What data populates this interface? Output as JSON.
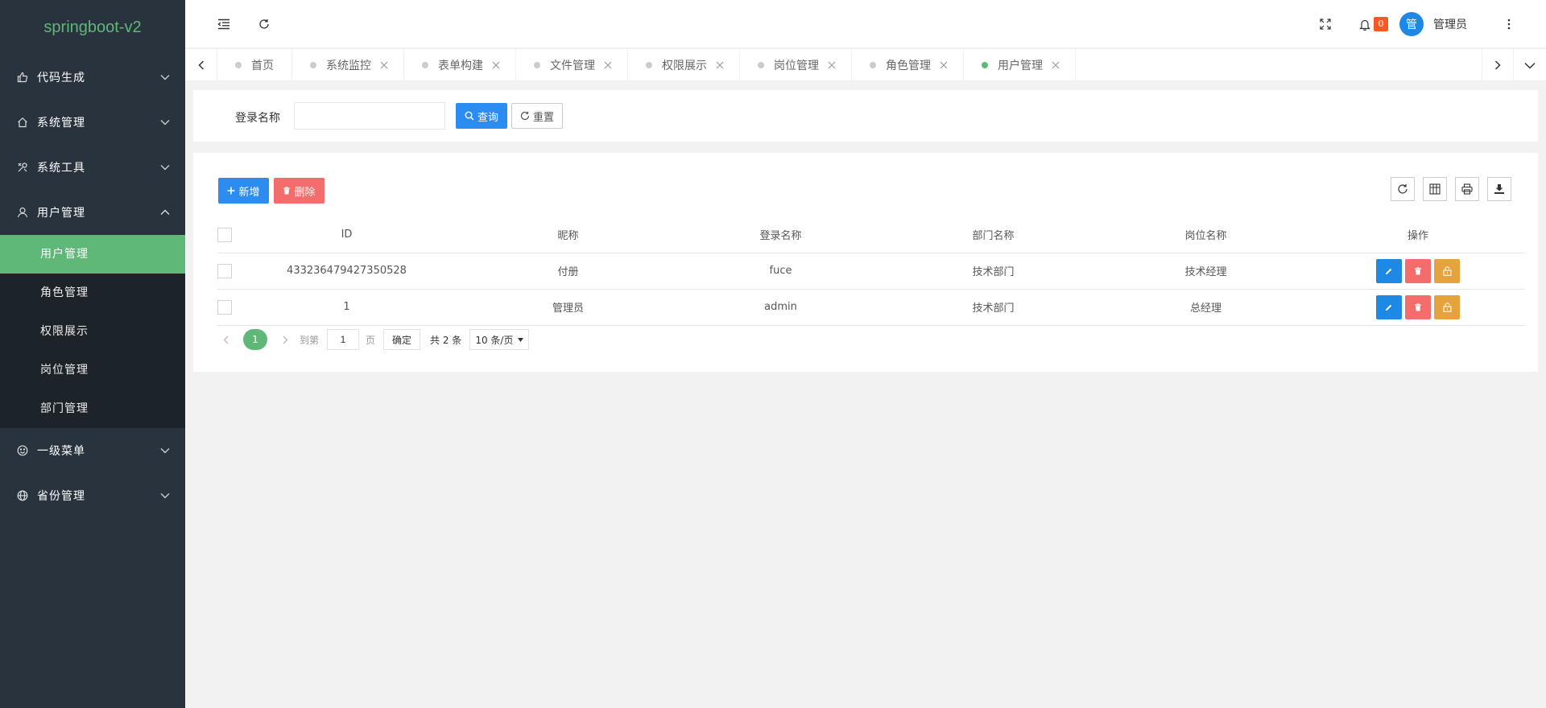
{
  "app": {
    "logo": "springboot-v2"
  },
  "sidebar": {
    "menu": [
      {
        "label": "代码生成",
        "icon": "thumbs-up-icon"
      },
      {
        "label": "系统管理",
        "icon": "home-icon"
      },
      {
        "label": "系统工具",
        "icon": "tools-icon"
      },
      {
        "label": "用户管理",
        "icon": "user-icon",
        "expanded": true
      }
    ],
    "submenu": [
      {
        "label": "用户管理",
        "active": true
      },
      {
        "label": "角色管理"
      },
      {
        "label": "权限展示"
      },
      {
        "label": "岗位管理"
      },
      {
        "label": "部门管理"
      }
    ],
    "menu_after": [
      {
        "label": "一级菜单",
        "icon": "smile-icon"
      },
      {
        "label": "省份管理",
        "icon": "globe-icon"
      }
    ]
  },
  "header": {
    "notification_count": "0",
    "avatar_text": "管",
    "username": "管理员"
  },
  "tabs": [
    {
      "label": "首页",
      "closable": false
    },
    {
      "label": "系统监控",
      "closable": true
    },
    {
      "label": "表单构建",
      "closable": true
    },
    {
      "label": "文件管理",
      "closable": true
    },
    {
      "label": "权限展示",
      "closable": true
    },
    {
      "label": "岗位管理",
      "closable": true
    },
    {
      "label": "角色管理",
      "closable": true
    },
    {
      "label": "用户管理",
      "closable": true,
      "active": true
    }
  ],
  "search": {
    "label": "登录名称",
    "value": "",
    "search_button": "查询",
    "reset_button": "重置"
  },
  "toolbar": {
    "add_button": "新增",
    "delete_button": "删除"
  },
  "table": {
    "columns": [
      "ID",
      "昵称",
      "登录名称",
      "部门名称",
      "岗位名称",
      "操作"
    ],
    "rows": [
      {
        "id": "433236479427350528",
        "nickname": "付册",
        "login": "fuce",
        "dept": "技术部门",
        "post": "技术经理"
      },
      {
        "id": "1",
        "nickname": "管理员",
        "login": "admin",
        "dept": "技术部门",
        "post": "总经理"
      }
    ]
  },
  "pager": {
    "current": "1",
    "goto_label": "到第",
    "goto_value": "1",
    "page_unit": "页",
    "confirm": "确定",
    "total": "共 2 条",
    "page_size": "10 条/页"
  },
  "colors": {
    "sidebar_bg": "#28333e",
    "accent_green": "#5fb878",
    "primary_blue": "#2d8cf0",
    "danger_red": "#f56c6c",
    "warning_orange": "#e6a23c",
    "badge_orange": "#ff5722"
  }
}
